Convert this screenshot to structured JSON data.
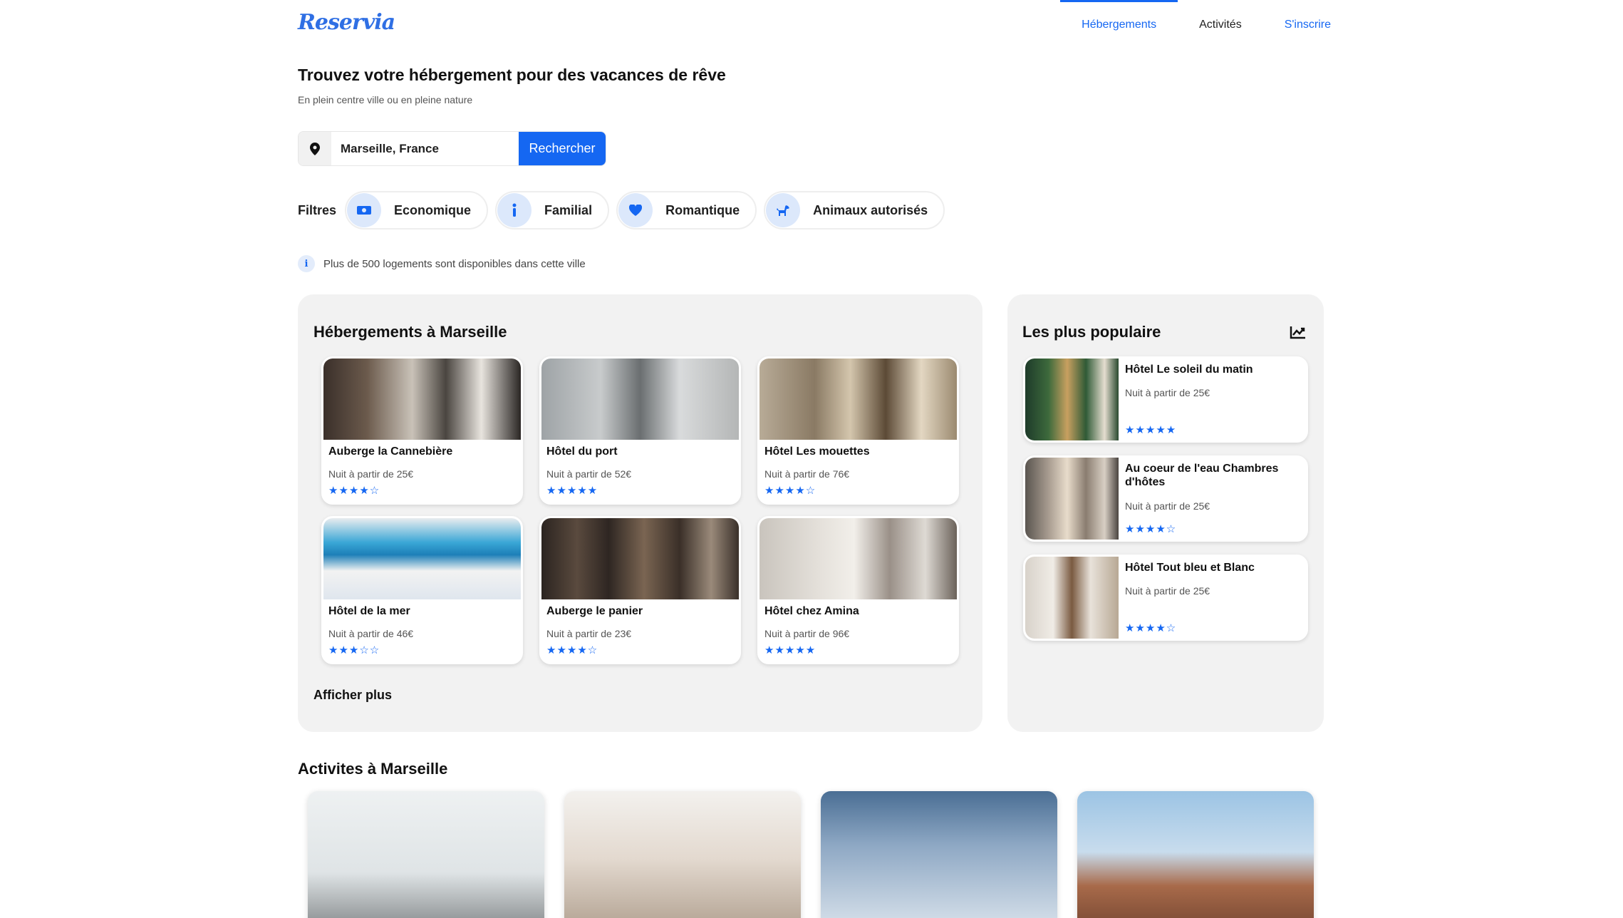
{
  "header": {
    "logo": "Reservia",
    "nav": [
      {
        "label": "Hébergements"
      },
      {
        "label": "Activités"
      },
      {
        "label": "S'inscrire"
      }
    ]
  },
  "hero": {
    "title": "Trouvez votre hébergement pour des vacances de rêve",
    "subtitle": "En plein centre ville ou en pleine nature"
  },
  "search": {
    "icon": "map-pin-icon",
    "value": "Marseille, France",
    "button_label": "Rechercher"
  },
  "filters": {
    "label": "Filtres",
    "items": [
      {
        "label": "Economique",
        "icon": "money-icon",
        "glyph": "💵"
      },
      {
        "label": "Familial",
        "icon": "child-icon",
        "glyph": "🚸"
      },
      {
        "label": "Romantique",
        "icon": "heart-icon",
        "glyph": "♥"
      },
      {
        "label": "Animaux autorisés",
        "icon": "dog-icon",
        "glyph": "🐕"
      }
    ]
  },
  "info": {
    "icon": "info-icon",
    "text": "Plus de 500 logements sont disponibles dans cette ville"
  },
  "accommodations": {
    "title": "Hébergements à Marseille",
    "more_label": "Afficher plus",
    "items": [
      {
        "name": "Auberge la Cannebière",
        "price": "Nuit à partir de 25€",
        "rating": 4,
        "stars": "★★★★☆"
      },
      {
        "name": "Hôtel du port",
        "price": "Nuit à partir de 52€",
        "rating": 5,
        "stars": "★★★★★"
      },
      {
        "name": "Hôtel Les mouettes",
        "price": "Nuit à partir de 76€",
        "rating": 4,
        "stars": "★★★★☆"
      },
      {
        "name": "Hôtel de la mer",
        "price": "Nuit à partir de 46€",
        "rating": 3,
        "stars": "★★★☆☆"
      },
      {
        "name": "Auberge le panier",
        "price": "Nuit à partir de 23€",
        "rating": 4,
        "stars": "★★★★☆"
      },
      {
        "name": "Hôtel chez Amina",
        "price": "Nuit à partir de 96€",
        "rating": 5,
        "stars": "★★★★★"
      }
    ]
  },
  "popular": {
    "title": "Les plus populaire",
    "icon": "trend-chart-icon",
    "items": [
      {
        "name": "Hôtel Le soleil du matin",
        "price": "Nuit à partir de 25€",
        "rating": 5,
        "stars": "★★★★★"
      },
      {
        "name": "Au coeur de l'eau Chambres d'hôtes",
        "price": "Nuit à partir de 25€",
        "rating": 4,
        "stars": "★★★★☆"
      },
      {
        "name": "Hôtel Tout bleu et Blanc",
        "price": "Nuit à partir de 25€",
        "rating": 4,
        "stars": "★★★★☆"
      }
    ]
  },
  "activities": {
    "title": "Activites à Marseille"
  },
  "colors": {
    "accent": "#1567f2",
    "panel": "#f2f2f2",
    "chip_icon_bg": "#dce8fb"
  }
}
